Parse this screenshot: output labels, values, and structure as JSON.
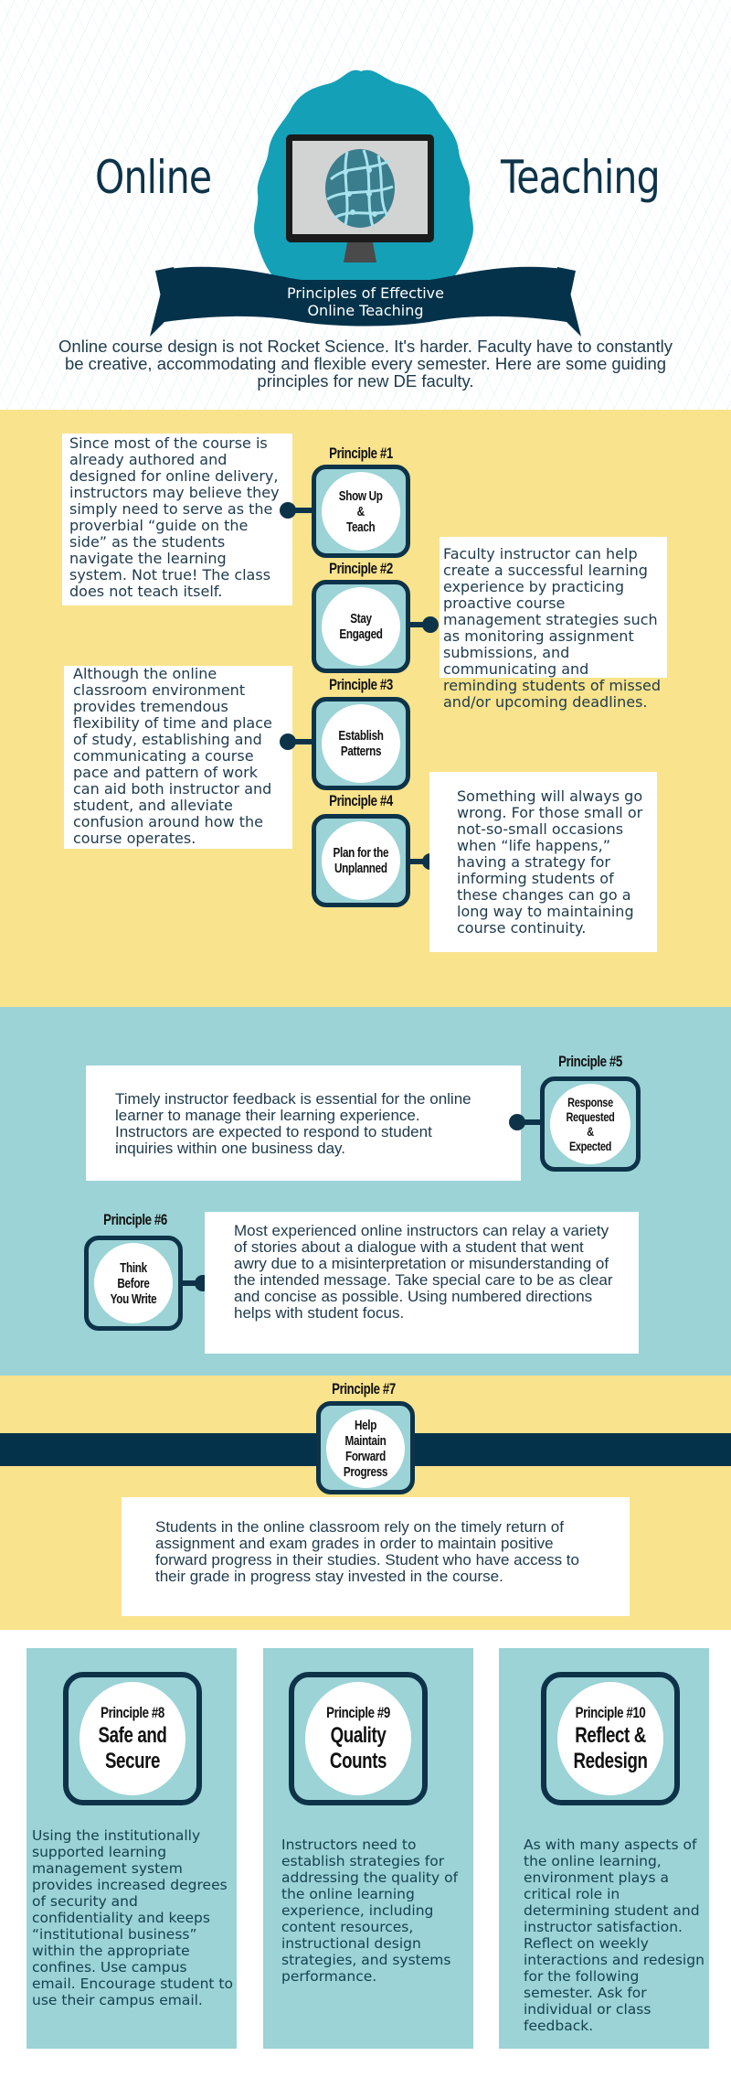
{
  "header": {
    "title_left": "Online",
    "title_right": "Teaching",
    "emblem_icon": "computer-monitor-globe-icon",
    "ribbon_line1": "Principles of Effective",
    "ribbon_line2": "Online Teaching",
    "intro": "Online course design is not Rocket Science.  It's harder. Faculty have to constantly be creative, accommodating and flexible every semester.  Here are some guiding principles for new DE faculty."
  },
  "colors": {
    "yellow": "#f9e38c",
    "teal": "#9bd3d6",
    "navy": "#0d3349",
    "badge_teal": "#14a0b7",
    "white": "#ffffff"
  },
  "principles": [
    {
      "label": "Principle #1",
      "name": "Show Up\n&\nTeach",
      "text": "Since most of the course is already authored and designed for online delivery, instructors may believe they simply need to serve as the proverbial “guide on the side” as the students navigate the learning system. Not true!  The class does not teach itself."
    },
    {
      "label": "Principle #2",
      "name": "Stay Engaged",
      "text": "Faculty instructor can help create a successful learning experience by practicing proactive course management strategies such as monitoring assignment submissions, and communicating and reminding students of missed and/or upcoming deadlines."
    },
    {
      "label": "Principle #3",
      "name": "Establish Patterns",
      "text": "Although the online classroom environment provides tremendous flexibility of time and place of study, establishing and communicating a course pace and pattern of work can aid both instructor and student, and alleviate confusion around how the course operates."
    },
    {
      "label": "Principle #4",
      "name": "Plan for the\nUnplanned",
      "text": "Something will always go wrong. For those small or not-so-small occasions when “life happens,” having a strategy for informing students of these changes can go a long way to maintaining course continuity."
    },
    {
      "label": "Principle #5",
      "name": "Response\nRequested\n&\nExpected",
      "text": "Timely instructor feedback is essential for the online learner to manage their learning experience. Instructors are expected to respond to student inquiries within one business day."
    },
    {
      "label": "Principle #6",
      "name": "Think Before\nYou Write",
      "text": "Most experienced online instructors can relay a variety of stories about a dialogue with a student that went awry due to a misinterpretation or misunderstanding of the intended message. Take special care to be as clear and concise as possible. Using numbered directions helps with student focus."
    },
    {
      "label": "Principle #7",
      "name": "Help Maintain\nForward Progress",
      "text": "Students in the online classroom rely on the timely return of assignment and exam grades in order to maintain positive forward progress in their studies.  Student who have access to their grade in progress stay invested in the course."
    },
    {
      "label": "Principle #8",
      "name": "Safe and Secure",
      "text": "Using the institutionally supported learning management system provides increased degrees of security and confidentiality and keeps “institutional business” within the appropriate confines.  Use campus email.  Encourage student to use their campus email."
    },
    {
      "label": "Principle #9",
      "name": "Quality Counts",
      "text": "Instructors need to establish strategies for addressing the quality of the online learning experience, including content resources, instructional design strategies, and systems performance."
    },
    {
      "label": "Principle #10",
      "name": "Reflect &\nRedesign",
      "text": "As with many aspects of the online learning, environment plays a critical role in determining student and instructor satisfaction. Reflect on weekly interactions and redesign for the following semester.  Ask for individual or class feedback."
    }
  ]
}
